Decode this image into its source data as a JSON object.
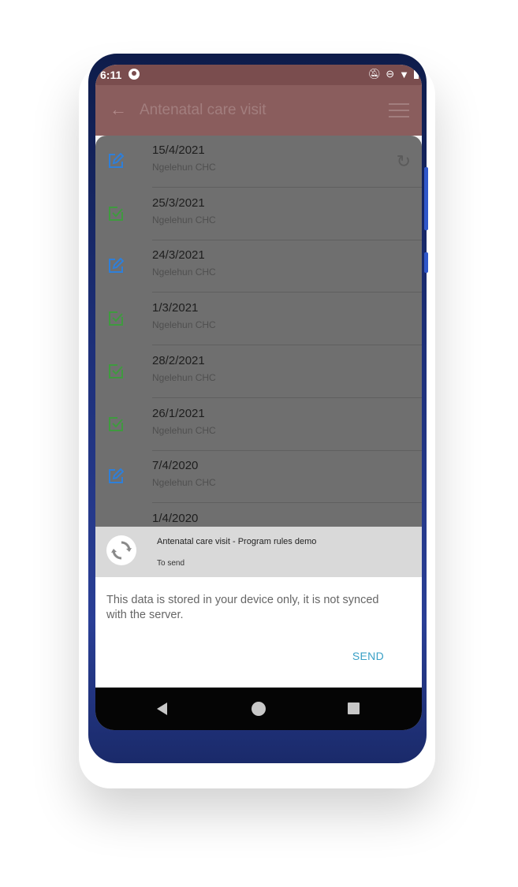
{
  "status_bar": {
    "time": "6:11",
    "icons": [
      "app-icon",
      "bell-off-icon",
      "do-not-disturb-icon",
      "wifi-icon",
      "battery-icon"
    ]
  },
  "app_bar": {
    "title": "Antenatal care visit",
    "back_icon": "arrow-back-icon",
    "filter_icon": "filter-icon"
  },
  "events": [
    {
      "date": "15/4/2021",
      "org": "Ngelehun CHC",
      "status": "edit",
      "synced": false
    },
    {
      "date": "25/3/2021",
      "org": "Ngelehun CHC",
      "status": "completed",
      "synced": true
    },
    {
      "date": "24/3/2021",
      "org": "Ngelehun CHC",
      "status": "edit",
      "synced": true
    },
    {
      "date": "1/3/2021",
      "org": "Ngelehun CHC",
      "status": "completed",
      "synced": true
    },
    {
      "date": "28/2/2021",
      "org": "Ngelehun CHC",
      "status": "completed",
      "synced": true
    },
    {
      "date": "26/1/2021",
      "org": "Ngelehun CHC",
      "status": "completed",
      "synced": true
    },
    {
      "date": "7/4/2020",
      "org": "Ngelehun CHC",
      "status": "edit",
      "synced": true
    },
    {
      "date": "1/4/2020",
      "org": "",
      "status": "",
      "synced": true
    }
  ],
  "sheet": {
    "title": "Antenatal care visit - Program rules demo",
    "subtitle": "To send",
    "message": "This data is stored in your device only, it is not synced with the server.",
    "send_label": "SEND"
  },
  "colors": {
    "edit_icon": "#2e7fd9",
    "completed_icon": "#3f9a3f",
    "send": "#3aa0c6",
    "app_bar": "#8a5d5d"
  }
}
